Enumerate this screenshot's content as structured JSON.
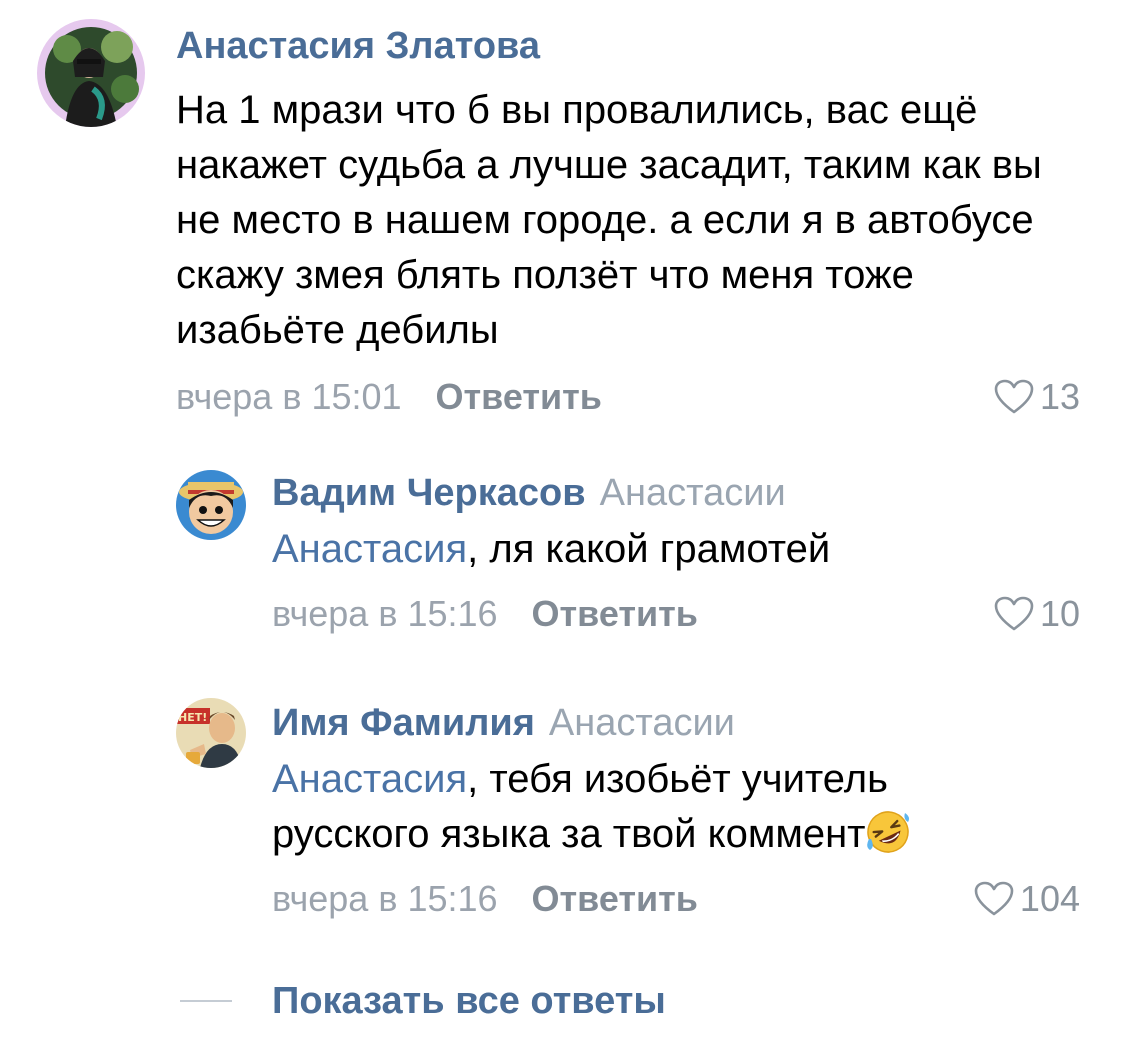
{
  "comments": [
    {
      "author": "Анастасия Златова",
      "reply_to": "",
      "mention": "",
      "text": "На 1 мрази что б вы провалились, вас ещё накажет судьба а лучше засадит, таким как вы не место в нашем городе. а если я в автобусе скажу змея блять ползёт что меня тоже изабьёте дебилы",
      "time": "вчера в 15:01",
      "reply_label": "Ответить",
      "likes": "13",
      "avatar_icon": "user-photo-avatar"
    },
    {
      "author": "Вадим Черкасов",
      "reply_to": "Анастасии",
      "mention": "Анастасия",
      "text": ", ля какой грамотей",
      "time": "вчера в 15:16",
      "reply_label": "Ответить",
      "likes": "10",
      "avatar_icon": "cartoon-avatar"
    },
    {
      "author": "Имя Фамилия",
      "reply_to": "Анастасии",
      "mention": "Анастасия",
      "text": ", тебя изобьёт учитель русского языка за твой коммент",
      "emoji": "rolling-on-floor-laughing-emoji",
      "time": "вчера в 15:16",
      "reply_label": "Ответить",
      "likes": "104",
      "avatar_icon": "poster-avatar"
    }
  ],
  "show_all_label": "Показать все ответы",
  "colors": {
    "author": "#4a6d97",
    "mention": "#4a73a6",
    "muted": "#9ba3ad"
  }
}
